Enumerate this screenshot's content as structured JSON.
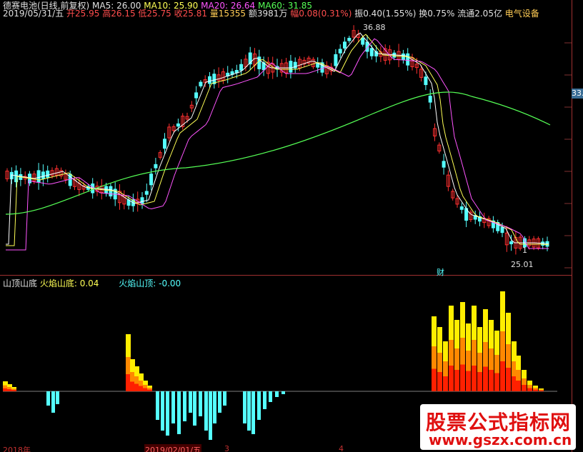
{
  "header": {
    "stock": "德赛电池(日线,前复权)",
    "ma5": "MA5: 26.00",
    "ma10": "MA10: 25.90",
    "ma20": "MA20: 26.64",
    "ma60": "MA60: 31.85",
    "date": "2019/05/31/五",
    "open": "开25.95",
    "high": "高26.15",
    "low": "低25.75",
    "close": "收25.81",
    "volume": "量15355",
    "amount": "额3981万",
    "change": "幅0.08(0.31%)",
    "amplitude": "振0.40(1.55%)",
    "turnover": "换0.75%",
    "float": "流通2.05亿",
    "sector": "电气设备"
  },
  "price_axis_label": "33.",
  "high_mark": "36.88",
  "low_mark": "25.01",
  "marker_cai": "财",
  "marker_one": "1",
  "indicator": {
    "name": "山顶山底",
    "bottom": "火焰山底: 0.04",
    "top": "火焰山顶: -0.00"
  },
  "xaxis": {
    "left": "2018年",
    "mid": "2019/02/01/五",
    "m3": "3",
    "m4": "4"
  },
  "watermark": {
    "line1": "股票公式指标网",
    "line2": "www.gszx.com.cn"
  },
  "colors": {
    "up": "#ff3030",
    "down": "#55ffff",
    "ma5": "#ffffff",
    "ma10": "#ffff55",
    "ma20": "#ff55ff",
    "ma60": "#55ff55",
    "flame_yellow": "#ffee00",
    "flame_orange": "#ff8800",
    "flame_red": "#ff2000",
    "cyan_bar": "#55ffff"
  }
}
